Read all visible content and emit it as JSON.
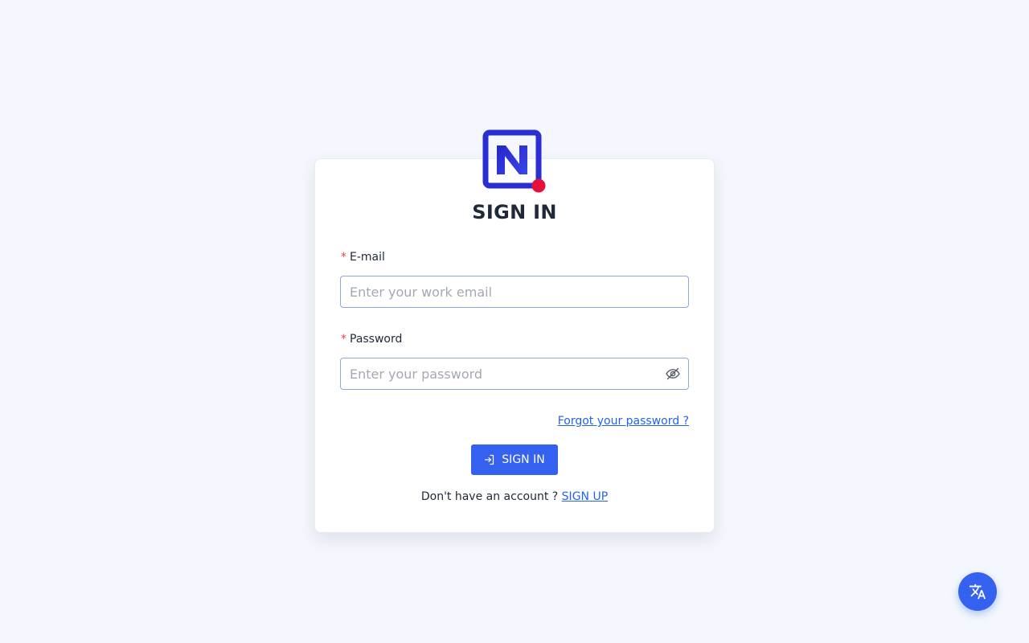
{
  "login": {
    "title": "SIGN IN",
    "email": {
      "label": "E-mail",
      "required_mark": "*",
      "placeholder": "Enter your work email",
      "value": ""
    },
    "password": {
      "label": "Password",
      "required_mark": "*",
      "placeholder": "Enter your password",
      "value": ""
    },
    "forgot_password": "Forgot your password ?",
    "signin_button": "SIGN IN",
    "signup_prompt": "Don't have an account ?",
    "signup_link": "SIGN UP"
  },
  "icons": {
    "logo": "n-logo-icon",
    "password_toggle": "eye-off-icon",
    "signin": "login-arrow-icon",
    "language": "translate-icon"
  },
  "colors": {
    "accent": "#3461f0",
    "link": "#2563eb",
    "logo_blue": "#2a2fd4",
    "logo_dot": "#e5113a",
    "required": "#ef4444",
    "background": "#f4f7fd"
  }
}
